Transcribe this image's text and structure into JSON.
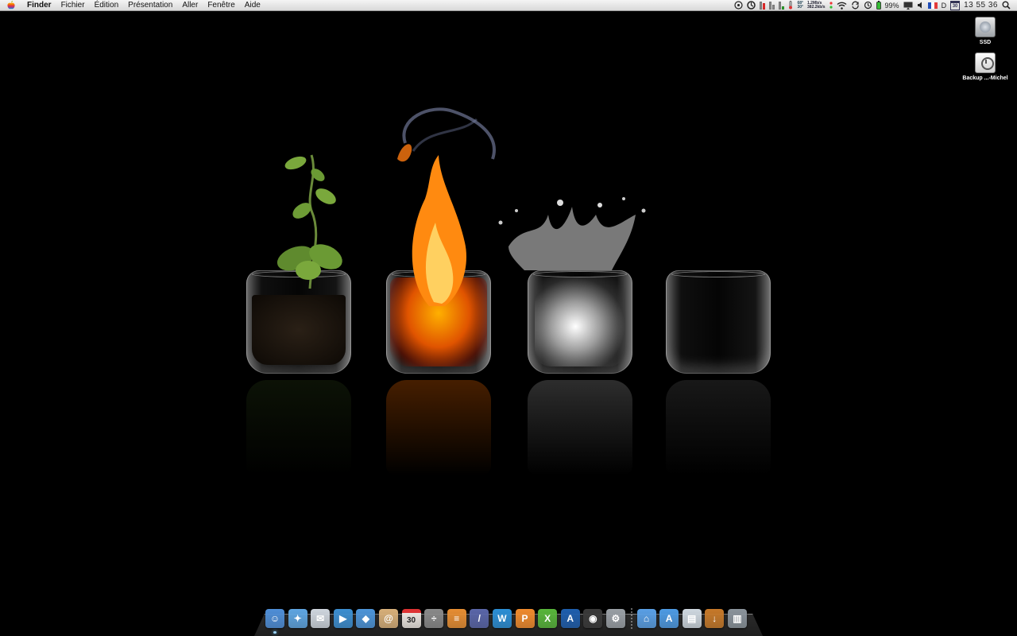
{
  "menubar": {
    "app_name": "Finder",
    "menus": [
      "Fichier",
      "Édition",
      "Présentation",
      "Aller",
      "Fenêtre",
      "Aide"
    ],
    "status": {
      "net_up": "1.2Mb/s",
      "net_down": "382.2kb/s",
      "temp_high": "68°",
      "temp_low": "30°",
      "battery": "99%",
      "input_source": "D",
      "calendar_day": "30",
      "clock": "13 55 36"
    }
  },
  "desktop_icons": [
    {
      "label": "SSD"
    },
    {
      "label": "Backup ...-Michel"
    }
  ],
  "dock": {
    "calendar_day": "30",
    "apps": [
      {
        "name": "finder",
        "color": "#4f8fd8",
        "glyph": "☺",
        "running": true
      },
      {
        "name": "safari",
        "color": "#5fa6e2",
        "glyph": "✦"
      },
      {
        "name": "mail",
        "color": "#cfd6de",
        "glyph": "✉"
      },
      {
        "name": "facetime",
        "color": "#3d8fd1",
        "glyph": "▶"
      },
      {
        "name": "dropbox",
        "color": "#4d95d9",
        "glyph": "◆"
      },
      {
        "name": "address-book",
        "color": "#d8b07a",
        "glyph": "@"
      },
      {
        "name": "ical",
        "color": "#e9e4de",
        "glyph": "30"
      },
      {
        "name": "calculator",
        "color": "#8a8a8a",
        "glyph": "÷"
      },
      {
        "name": "stickies",
        "color": "#e78e33",
        "glyph": "≡"
      },
      {
        "name": "pixelmator",
        "color": "#5a66a9",
        "glyph": "/"
      },
      {
        "name": "word",
        "color": "#2c8fd6",
        "glyph": "W"
      },
      {
        "name": "powerpoint",
        "color": "#f08b2d",
        "glyph": "P"
      },
      {
        "name": "excel",
        "color": "#58b63b",
        "glyph": "X"
      },
      {
        "name": "app-store",
        "color": "#1f5fae",
        "glyph": "A"
      },
      {
        "name": "aperture",
        "color": "#3a3a3a",
        "glyph": "◉"
      },
      {
        "name": "system-preferences",
        "color": "#9aa0a6",
        "glyph": "⚙"
      }
    ],
    "stacks": [
      {
        "name": "home-folder",
        "color": "#5aa0e6",
        "glyph": "⌂"
      },
      {
        "name": "applications-folder",
        "color": "#4e9be4",
        "glyph": "A"
      },
      {
        "name": "documents-folder",
        "color": "#cfd8e0",
        "glyph": "▤"
      },
      {
        "name": "downloads-folder",
        "color": "#c77a2a",
        "glyph": "↓"
      },
      {
        "name": "trash",
        "color": "#8b949c",
        "glyph": "▥"
      }
    ]
  }
}
